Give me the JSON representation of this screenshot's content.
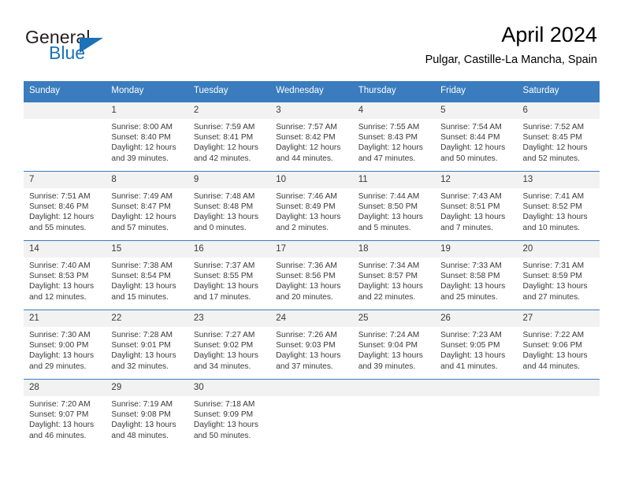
{
  "brand": {
    "name_part1": "General",
    "name_part2": "Blue",
    "triangle_color": "#1b72b8"
  },
  "header": {
    "title": "April 2024",
    "subtitle": "Pulgar, Castille-La Mancha, Spain"
  },
  "theme": {
    "header_blue": "#3a7cbe",
    "daynum_band": "#f2f2f2",
    "text": "#3a3a3a"
  },
  "weekdays": [
    "Sunday",
    "Monday",
    "Tuesday",
    "Wednesday",
    "Thursday",
    "Friday",
    "Saturday"
  ],
  "labels": {
    "sunrise": "Sunrise:",
    "sunset": "Sunset:",
    "daylight": "Daylight:"
  },
  "weeks": [
    [
      {
        "day": "",
        "sunrise": "",
        "sunset": "",
        "daylight_line1": "",
        "daylight_line2": "",
        "blank": true
      },
      {
        "day": "1",
        "sunrise": "Sunrise: 8:00 AM",
        "sunset": "Sunset: 8:40 PM",
        "daylight_line1": "Daylight: 12 hours",
        "daylight_line2": "and 39 minutes."
      },
      {
        "day": "2",
        "sunrise": "Sunrise: 7:59 AM",
        "sunset": "Sunset: 8:41 PM",
        "daylight_line1": "Daylight: 12 hours",
        "daylight_line2": "and 42 minutes."
      },
      {
        "day": "3",
        "sunrise": "Sunrise: 7:57 AM",
        "sunset": "Sunset: 8:42 PM",
        "daylight_line1": "Daylight: 12 hours",
        "daylight_line2": "and 44 minutes."
      },
      {
        "day": "4",
        "sunrise": "Sunrise: 7:55 AM",
        "sunset": "Sunset: 8:43 PM",
        "daylight_line1": "Daylight: 12 hours",
        "daylight_line2": "and 47 minutes."
      },
      {
        "day": "5",
        "sunrise": "Sunrise: 7:54 AM",
        "sunset": "Sunset: 8:44 PM",
        "daylight_line1": "Daylight: 12 hours",
        "daylight_line2": "and 50 minutes."
      },
      {
        "day": "6",
        "sunrise": "Sunrise: 7:52 AM",
        "sunset": "Sunset: 8:45 PM",
        "daylight_line1": "Daylight: 12 hours",
        "daylight_line2": "and 52 minutes."
      }
    ],
    [
      {
        "day": "7",
        "sunrise": "Sunrise: 7:51 AM",
        "sunset": "Sunset: 8:46 PM",
        "daylight_line1": "Daylight: 12 hours",
        "daylight_line2": "and 55 minutes."
      },
      {
        "day": "8",
        "sunrise": "Sunrise: 7:49 AM",
        "sunset": "Sunset: 8:47 PM",
        "daylight_line1": "Daylight: 12 hours",
        "daylight_line2": "and 57 minutes."
      },
      {
        "day": "9",
        "sunrise": "Sunrise: 7:48 AM",
        "sunset": "Sunset: 8:48 PM",
        "daylight_line1": "Daylight: 13 hours",
        "daylight_line2": "and 0 minutes."
      },
      {
        "day": "10",
        "sunrise": "Sunrise: 7:46 AM",
        "sunset": "Sunset: 8:49 PM",
        "daylight_line1": "Daylight: 13 hours",
        "daylight_line2": "and 2 minutes."
      },
      {
        "day": "11",
        "sunrise": "Sunrise: 7:44 AM",
        "sunset": "Sunset: 8:50 PM",
        "daylight_line1": "Daylight: 13 hours",
        "daylight_line2": "and 5 minutes."
      },
      {
        "day": "12",
        "sunrise": "Sunrise: 7:43 AM",
        "sunset": "Sunset: 8:51 PM",
        "daylight_line1": "Daylight: 13 hours",
        "daylight_line2": "and 7 minutes."
      },
      {
        "day": "13",
        "sunrise": "Sunrise: 7:41 AM",
        "sunset": "Sunset: 8:52 PM",
        "daylight_line1": "Daylight: 13 hours",
        "daylight_line2": "and 10 minutes."
      }
    ],
    [
      {
        "day": "14",
        "sunrise": "Sunrise: 7:40 AM",
        "sunset": "Sunset: 8:53 PM",
        "daylight_line1": "Daylight: 13 hours",
        "daylight_line2": "and 12 minutes."
      },
      {
        "day": "15",
        "sunrise": "Sunrise: 7:38 AM",
        "sunset": "Sunset: 8:54 PM",
        "daylight_line1": "Daylight: 13 hours",
        "daylight_line2": "and 15 minutes."
      },
      {
        "day": "16",
        "sunrise": "Sunrise: 7:37 AM",
        "sunset": "Sunset: 8:55 PM",
        "daylight_line1": "Daylight: 13 hours",
        "daylight_line2": "and 17 minutes."
      },
      {
        "day": "17",
        "sunrise": "Sunrise: 7:36 AM",
        "sunset": "Sunset: 8:56 PM",
        "daylight_line1": "Daylight: 13 hours",
        "daylight_line2": "and 20 minutes."
      },
      {
        "day": "18",
        "sunrise": "Sunrise: 7:34 AM",
        "sunset": "Sunset: 8:57 PM",
        "daylight_line1": "Daylight: 13 hours",
        "daylight_line2": "and 22 minutes."
      },
      {
        "day": "19",
        "sunrise": "Sunrise: 7:33 AM",
        "sunset": "Sunset: 8:58 PM",
        "daylight_line1": "Daylight: 13 hours",
        "daylight_line2": "and 25 minutes."
      },
      {
        "day": "20",
        "sunrise": "Sunrise: 7:31 AM",
        "sunset": "Sunset: 8:59 PM",
        "daylight_line1": "Daylight: 13 hours",
        "daylight_line2": "and 27 minutes."
      }
    ],
    [
      {
        "day": "21",
        "sunrise": "Sunrise: 7:30 AM",
        "sunset": "Sunset: 9:00 PM",
        "daylight_line1": "Daylight: 13 hours",
        "daylight_line2": "and 29 minutes."
      },
      {
        "day": "22",
        "sunrise": "Sunrise: 7:28 AM",
        "sunset": "Sunset: 9:01 PM",
        "daylight_line1": "Daylight: 13 hours",
        "daylight_line2": "and 32 minutes."
      },
      {
        "day": "23",
        "sunrise": "Sunrise: 7:27 AM",
        "sunset": "Sunset: 9:02 PM",
        "daylight_line1": "Daylight: 13 hours",
        "daylight_line2": "and 34 minutes."
      },
      {
        "day": "24",
        "sunrise": "Sunrise: 7:26 AM",
        "sunset": "Sunset: 9:03 PM",
        "daylight_line1": "Daylight: 13 hours",
        "daylight_line2": "and 37 minutes."
      },
      {
        "day": "25",
        "sunrise": "Sunrise: 7:24 AM",
        "sunset": "Sunset: 9:04 PM",
        "daylight_line1": "Daylight: 13 hours",
        "daylight_line2": "and 39 minutes."
      },
      {
        "day": "26",
        "sunrise": "Sunrise: 7:23 AM",
        "sunset": "Sunset: 9:05 PM",
        "daylight_line1": "Daylight: 13 hours",
        "daylight_line2": "and 41 minutes."
      },
      {
        "day": "27",
        "sunrise": "Sunrise: 7:22 AM",
        "sunset": "Sunset: 9:06 PM",
        "daylight_line1": "Daylight: 13 hours",
        "daylight_line2": "and 44 minutes."
      }
    ],
    [
      {
        "day": "28",
        "sunrise": "Sunrise: 7:20 AM",
        "sunset": "Sunset: 9:07 PM",
        "daylight_line1": "Daylight: 13 hours",
        "daylight_line2": "and 46 minutes."
      },
      {
        "day": "29",
        "sunrise": "Sunrise: 7:19 AM",
        "sunset": "Sunset: 9:08 PM",
        "daylight_line1": "Daylight: 13 hours",
        "daylight_line2": "and 48 minutes."
      },
      {
        "day": "30",
        "sunrise": "Sunrise: 7:18 AM",
        "sunset": "Sunset: 9:09 PM",
        "daylight_line1": "Daylight: 13 hours",
        "daylight_line2": "and 50 minutes."
      },
      {
        "day": "",
        "sunrise": "",
        "sunset": "",
        "daylight_line1": "",
        "daylight_line2": "",
        "blank": true
      },
      {
        "day": "",
        "sunrise": "",
        "sunset": "",
        "daylight_line1": "",
        "daylight_line2": "",
        "blank": true
      },
      {
        "day": "",
        "sunrise": "",
        "sunset": "",
        "daylight_line1": "",
        "daylight_line2": "",
        "blank": true
      },
      {
        "day": "",
        "sunrise": "",
        "sunset": "",
        "daylight_line1": "",
        "daylight_line2": "",
        "blank": true
      }
    ]
  ]
}
